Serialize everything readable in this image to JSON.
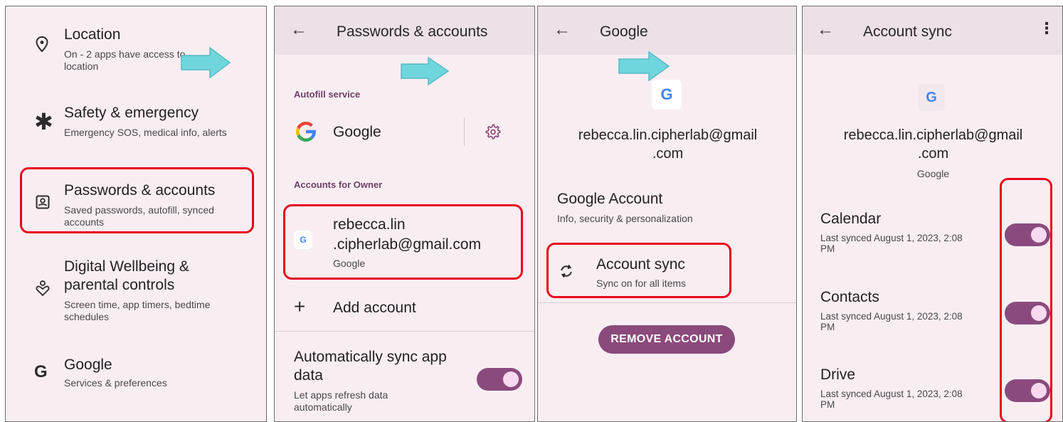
{
  "colors": {
    "panel_bg": "#f8eef2",
    "appbar_bg": "#ebe1e6",
    "accent": "#8a4a7b",
    "highlight_box": "#e8001c",
    "arrow": "#6fd6dd"
  },
  "panel1": {
    "items": [
      {
        "icon": "location-pin-icon",
        "title": "Location",
        "subtitle": "On - 2 apps have access to location"
      },
      {
        "icon": "asterisk-icon",
        "title": "Safety & emergency",
        "subtitle": "Emergency SOS, medical info, alerts"
      },
      {
        "icon": "account-box-icon",
        "title": "Passwords & accounts",
        "subtitle": "Saved passwords, autofill, synced accounts"
      },
      {
        "icon": "wellbeing-icon",
        "title": "Digital Wellbeing & parental controls",
        "subtitle": "Screen time, app timers, bedtime schedules"
      },
      {
        "icon": "google-g-icon",
        "title": "Google",
        "subtitle": "Services & preferences"
      }
    ]
  },
  "panel2": {
    "title": "Passwords & accounts",
    "autofill_section": "Autofill service",
    "autofill_provider": "Google",
    "accounts_section": "Accounts for Owner",
    "account_line1": "rebecca.lin",
    "account_line2": ".cipherlab@gmail.com",
    "account_type": "Google",
    "add_account": "Add account",
    "autosync_title": "Automatically sync app data",
    "autosync_subtitle": "Let apps refresh data automatically",
    "autosync_on": true
  },
  "panel3": {
    "title": "Google",
    "email_line1": "rebecca.lin.cipherlab@gmail",
    "email_line2": ".com",
    "google_account_title": "Google Account",
    "google_account_subtitle": "Info, security & personalization",
    "account_sync_title": "Account sync",
    "account_sync_subtitle": "Sync on for all items",
    "remove_button": "REMOVE ACCOUNT"
  },
  "panel4": {
    "title": "Account sync",
    "email_line1": "rebecca.lin.cipherlab@gmail",
    "email_line2": ".com",
    "account_type": "Google",
    "items": [
      {
        "name": "Calendar",
        "line1": "Last synced August 1, 2023, 2:08",
        "line2": "PM",
        "on": true
      },
      {
        "name": "Contacts",
        "line1": "Last synced August 1, 2023, 2:08",
        "line2": "PM",
        "on": true
      },
      {
        "name": "Drive",
        "line1": "Last synced August 1, 2023, 2:08",
        "line2": "PM",
        "on": true
      }
    ]
  }
}
